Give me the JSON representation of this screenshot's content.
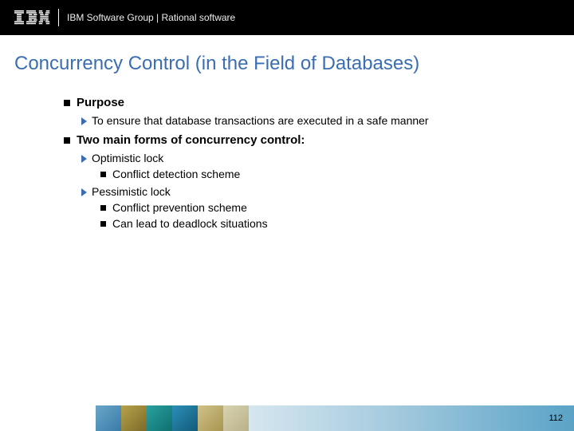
{
  "header": {
    "logo_alt": "IBM",
    "text": "IBM Software Group | Rational software"
  },
  "title": "Concurrency Control (in the Field of Databases)",
  "bullets": {
    "purpose_label": "Purpose",
    "purpose_detail": "To ensure that database transactions are executed in a safe manner",
    "forms_label": "Two main forms of concurrency control:",
    "optimistic_label": "Optimistic lock",
    "optimistic_detail": "Conflict detection scheme",
    "pessimistic_label": "Pessimistic lock",
    "pessimistic_detail1": "Conflict prevention scheme",
    "pessimistic_detail2": "Can lead to deadlock situations"
  },
  "footer": {
    "page_number": "112"
  }
}
